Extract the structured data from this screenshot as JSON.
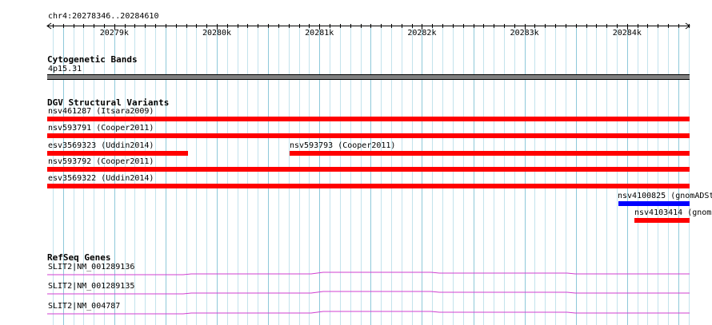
{
  "region": {
    "label": "chr4:20278346..20284610",
    "start": 20278346,
    "end": 20284610
  },
  "ruler": {
    "ticks": [
      {
        "pos": 20279000,
        "label": "20279k"
      },
      {
        "pos": 20280000,
        "label": "20280k"
      },
      {
        "pos": 20281000,
        "label": "20281k"
      },
      {
        "pos": 20282000,
        "label": "20282k"
      },
      {
        "pos": 20283000,
        "label": "20283k"
      },
      {
        "pos": 20284000,
        "label": "20284k"
      }
    ]
  },
  "tracks": {
    "cytoband": {
      "title": "Cytogenetic Bands",
      "band_label": "4p15.31",
      "color": "#808080"
    },
    "dgv": {
      "title": "DGV Structural Variants",
      "features": [
        {
          "label": "nsv461287 (Itsara2009)",
          "color": "#ff0000"
        },
        {
          "label": "nsv593791 (Cooper2011)",
          "color": "#ff0000"
        },
        {
          "label": "esv3569323 (Uddin2014)",
          "color": "#ff0000"
        },
        {
          "label": "nsv593793 (Cooper2011)",
          "color": "#ff0000"
        },
        {
          "label": "nsv593792 (Cooper2011)",
          "color": "#ff0000"
        },
        {
          "label": "esv3569322 (Uddin2014)",
          "color": "#ff0000"
        },
        {
          "label": "nsv4100825 (gnomADSt",
          "color": "#0000ff"
        },
        {
          "label": "nsv4103414 (gnom",
          "color": "#ff0000"
        }
      ]
    },
    "refseq": {
      "title": "RefSeq Genes",
      "color": "#d040d0",
      "transcripts": [
        {
          "label": "SLIT2|NM_001289136"
        },
        {
          "label": "SLIT2|NM_001289135"
        },
        {
          "label": "SLIT2|NM_004787"
        }
      ]
    }
  },
  "colors": {
    "grid_major": "#8ec9da",
    "grid_minor": "#c3e3ec"
  }
}
